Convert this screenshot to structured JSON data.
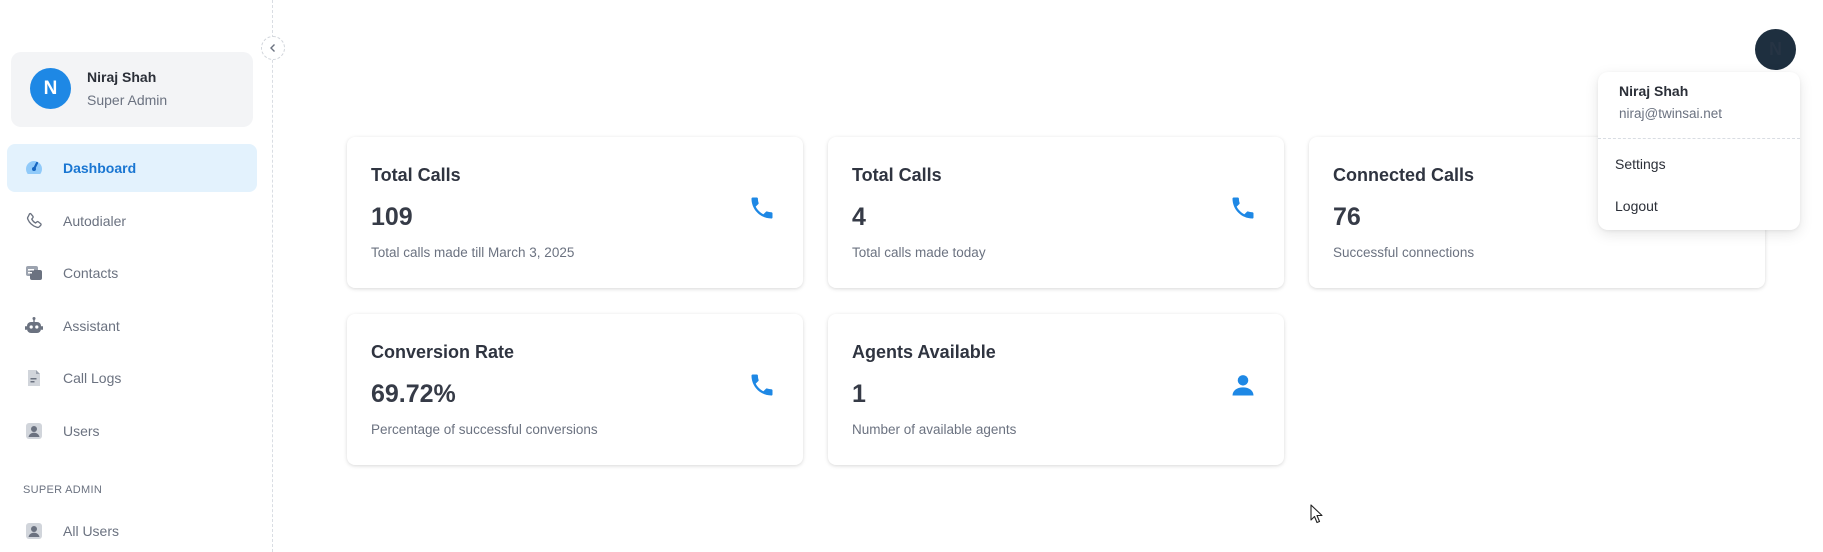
{
  "user": {
    "initial": "N",
    "name": "Niraj Shah",
    "role": "Super Admin",
    "email": "niraj@twinsai.net"
  },
  "sidebar": {
    "collapse_icon": "chevron-left-icon",
    "items": [
      {
        "label": "Dashboard",
        "icon": "speedometer-icon",
        "active": true
      },
      {
        "label": "Autodialer",
        "icon": "phone-outline-icon",
        "active": false
      },
      {
        "label": "Contacts",
        "icon": "contacts-icon",
        "active": false
      },
      {
        "label": "Assistant",
        "icon": "robot-icon",
        "active": false
      },
      {
        "label": "Call Logs",
        "icon": "document-icon",
        "active": false
      },
      {
        "label": "Users",
        "icon": "user-badge-icon",
        "active": false
      }
    ],
    "section_title": "SUPER ADMIN",
    "admin_items": [
      {
        "label": "All Users",
        "icon": "user-badge-icon"
      }
    ]
  },
  "cards": [
    {
      "title": "Total Calls",
      "value": "109",
      "description": "Total calls made till March 3, 2025",
      "icon": "phone-icon"
    },
    {
      "title": "Total Calls",
      "value": "4",
      "description": "Total calls made today",
      "icon": "phone-icon"
    },
    {
      "title": "Connected Calls",
      "value": "76",
      "description": "Successful connections",
      "icon": "phone-icon"
    },
    {
      "title": "Conversion Rate",
      "value": "69.72%",
      "description": "Percentage of successful conversions",
      "icon": "phone-icon"
    },
    {
      "title": "Agents Available",
      "value": "1",
      "description": "Number of available agents",
      "icon": "person-icon"
    }
  ],
  "menu": {
    "settings_label": "Settings",
    "logout_label": "Logout"
  },
  "colors": {
    "accent": "#1976d2",
    "icon_blue": "#1e88e5",
    "active_bg": "#e3f2fd"
  }
}
